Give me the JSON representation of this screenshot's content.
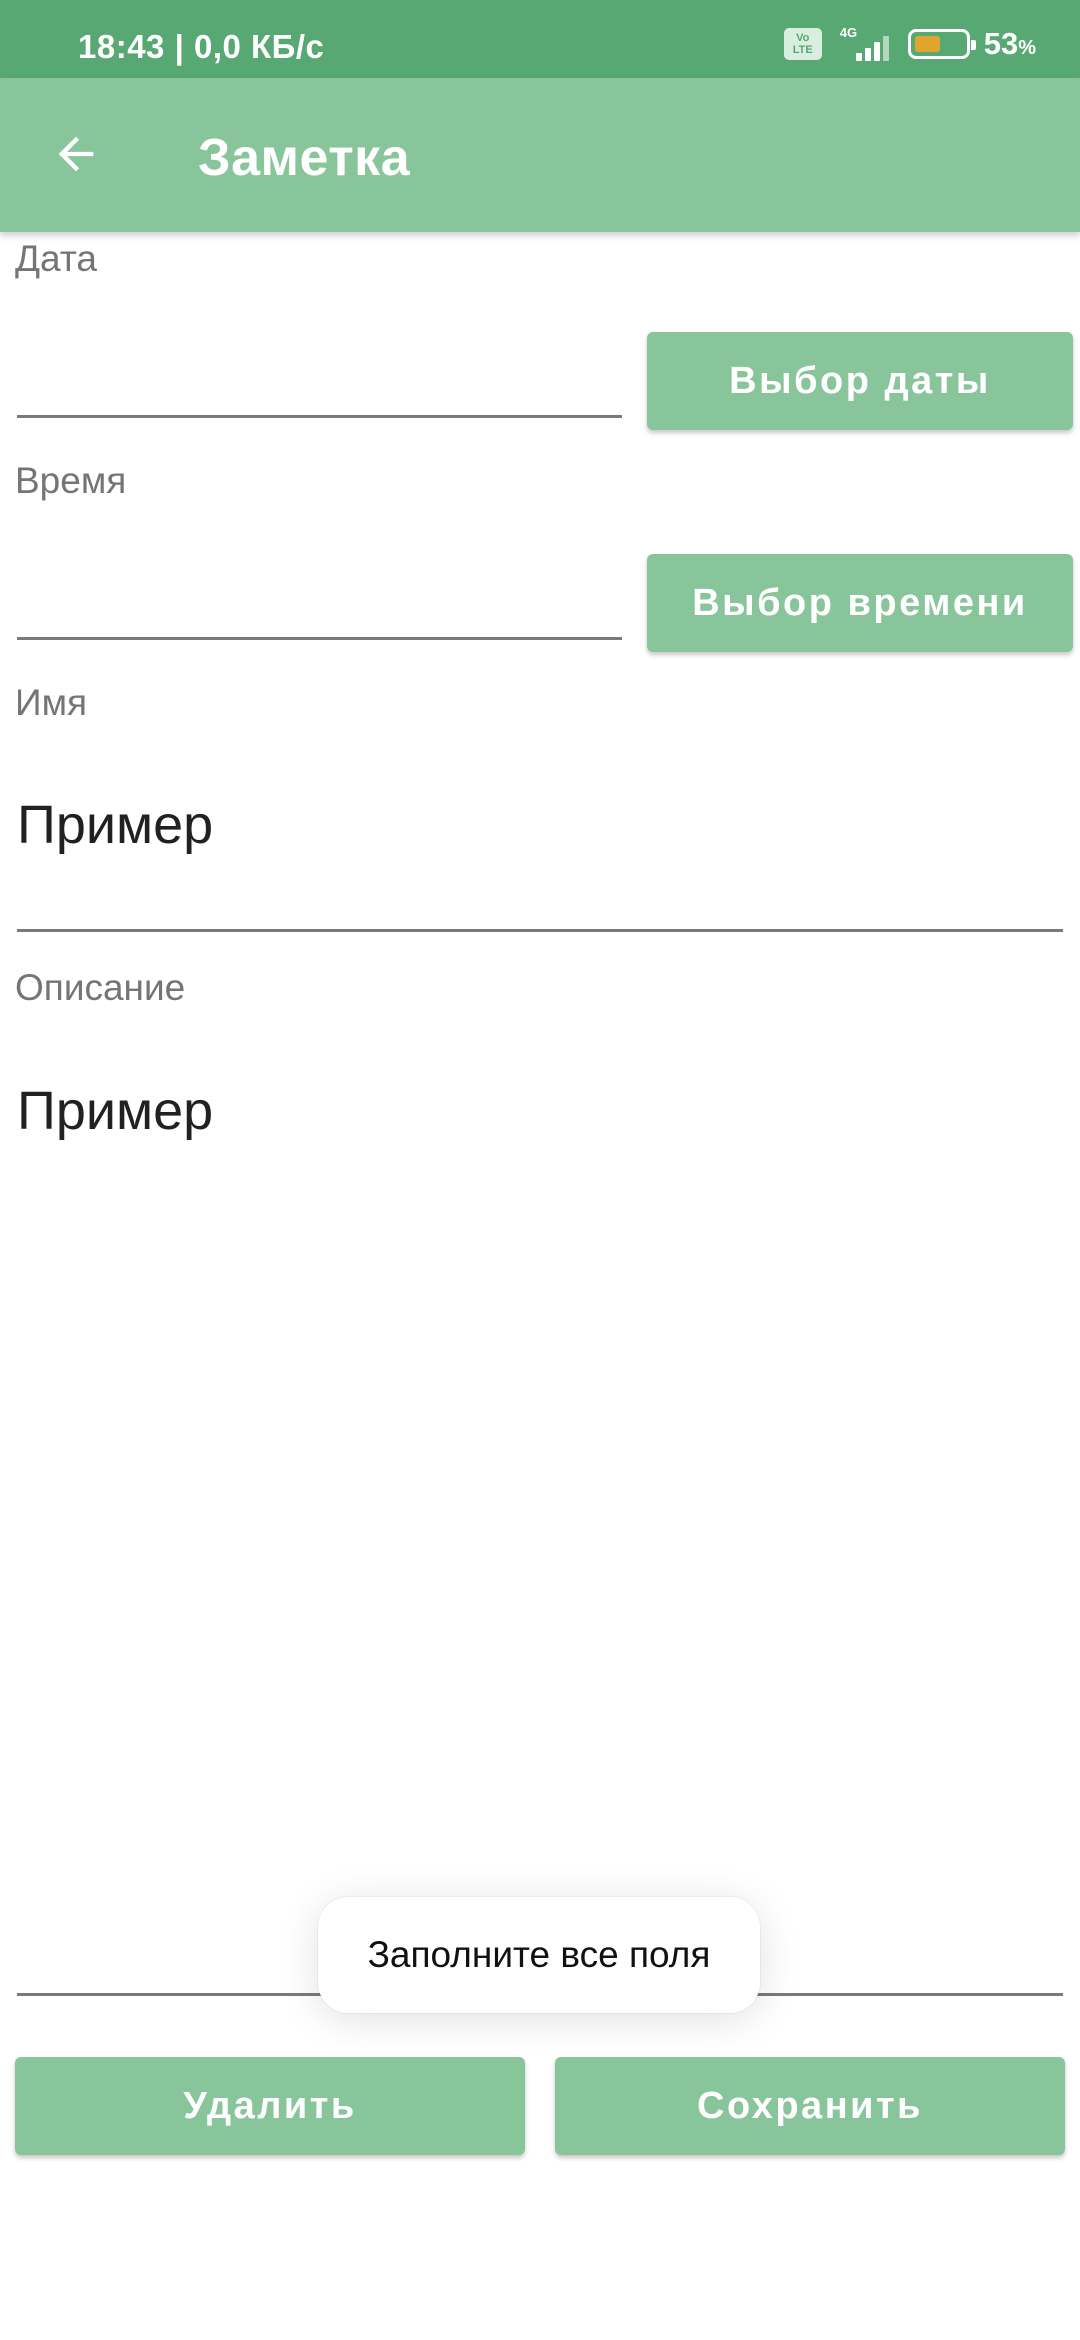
{
  "status_bar": {
    "time": "18:43",
    "speed": "0,0 КБ/с",
    "volte_line1": "Vo",
    "volte_line2": "LTE",
    "network": "4G",
    "battery_percent": "53",
    "battery_unit": "%",
    "battery_level": 0.53,
    "icons": [
      "volte-icon",
      "signal-icon",
      "battery-icon"
    ]
  },
  "app_bar": {
    "title": "Заметка",
    "back_icon": "arrow-left-icon"
  },
  "form": {
    "date": {
      "label": "Дата",
      "value": "",
      "button": "Выбор даты"
    },
    "time": {
      "label": "Время",
      "value": "",
      "button": "Выбор времени"
    },
    "name": {
      "label": "Имя",
      "value": "Пример"
    },
    "description": {
      "label": "Описание",
      "value": "Пример"
    }
  },
  "actions": {
    "delete": "Удалить",
    "save": "Сохранить"
  },
  "toast": {
    "message": "Заполните все поля"
  },
  "colors": {
    "status_bar": "#57a872",
    "app_bar": "#88c59b",
    "button": "#88c59b",
    "label": "#757575",
    "underline": "#7a7a7a",
    "battery_fill": "#e0a52e"
  }
}
